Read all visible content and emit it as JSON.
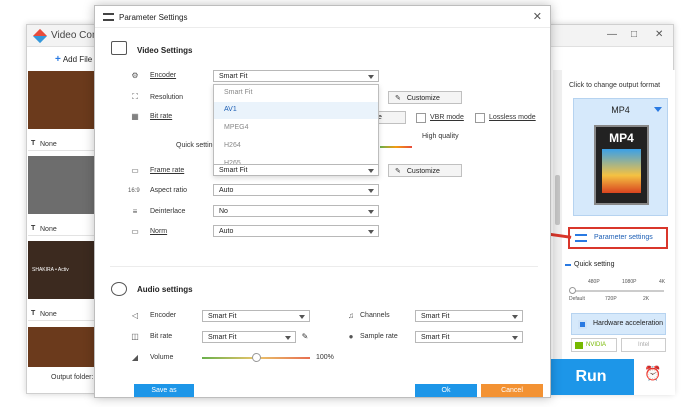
{
  "bg_app": {
    "title": "Video Conv",
    "add_files": "Add File",
    "add_plus": "+",
    "output_folder": "Output folder:",
    "controls": [
      "—",
      "□",
      "✕"
    ],
    "items": [
      {
        "subtitle": "None"
      },
      {
        "subtitle": "None"
      },
      {
        "subtitle": "None"
      }
    ],
    "thumb_colors": [
      "#6b3a1c",
      "#6d6d6d",
      "#3c2a1f"
    ],
    "thumb_caption": "SHAKIRA • Activ"
  },
  "right_panel": {
    "title": "Click to change output format",
    "format": "MP4",
    "format_icon_text": "MP4",
    "param_settings": "Parameter settings",
    "quick_setting": "Quick setting",
    "ticks_top": [
      "480P",
      "1080P",
      "4K"
    ],
    "ticks_bottom": [
      "Default",
      "720P",
      "2K"
    ],
    "hardware_accel": "Hardware acceleration",
    "nvidia": "NVIDIA",
    "intel": "Intel",
    "run": "Run",
    "alarm_icon": "⏰"
  },
  "dialog": {
    "title": "Parameter Settings",
    "close": "✕",
    "video_section": "Video Settings",
    "audio_section": "Audio settings",
    "video": {
      "encoder_label": "Encoder",
      "encoder_value": "Smart Fit",
      "resolution_label": "Resolution",
      "bitrate_label": "Bit rate",
      "customize": "Customize",
      "bitrate_customize_partial": "ize",
      "vbr_mode": "VBR mode",
      "lossless_mode": "Lossless mode",
      "high_quality": "High quality",
      "quick_setting_partial": "Quick setting",
      "framerate_label": "Frame rate",
      "framerate_value": "Smart Fit",
      "aspect_label": "Aspect ratio",
      "aspect_value": "Auto",
      "deinterlace_label": "Deinterlace",
      "deinterlace_value": "No",
      "norm_label": "Norm",
      "norm_value": "Auto"
    },
    "encoder_options": [
      "Smart Fit",
      "AV1",
      "MPEG4",
      "H264",
      "H265"
    ],
    "encoder_selected": "AV1",
    "audio": {
      "encoder_label": "Encoder",
      "encoder_value": "Smart Fit",
      "channels_label": "Channels",
      "channels_value": "Smart Fit",
      "bitrate_label": "Bit rate",
      "bitrate_value": "Smart Fit",
      "samplerate_label": "Sample rate",
      "samplerate_value": "Smart Fit",
      "volume_label": "Volume",
      "volume_value": "100%",
      "volume_level": 0.5
    },
    "buttons": {
      "save_as": "Save as",
      "ok": "Ok",
      "cancel": "Cancel"
    }
  },
  "colors": {
    "accent": "#1d96e8",
    "cancel": "#f39233",
    "highlight": "#d9362b"
  }
}
